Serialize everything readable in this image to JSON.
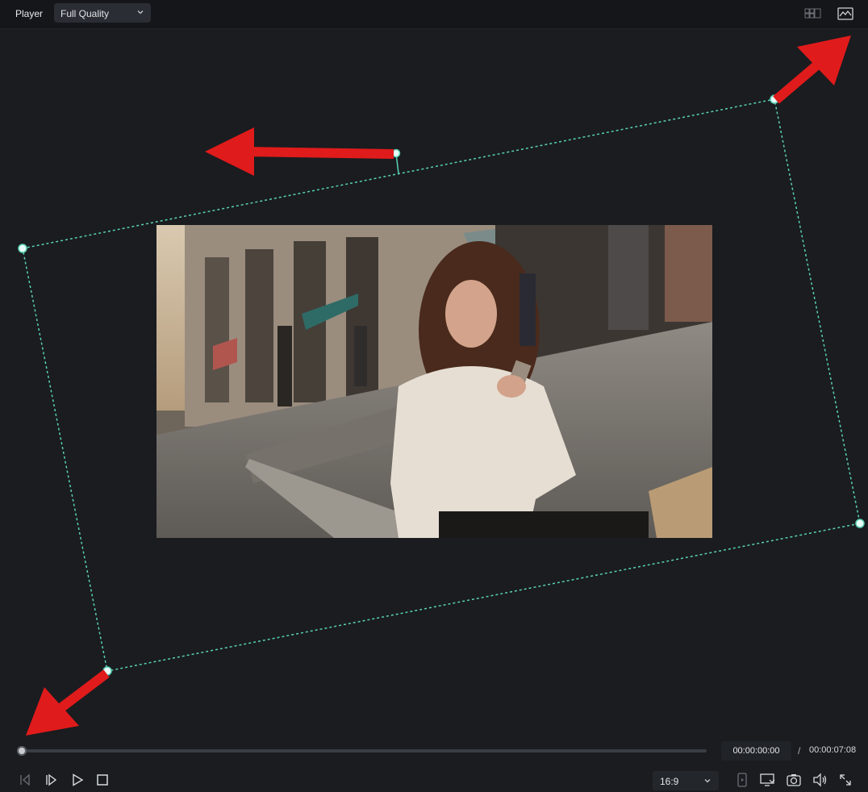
{
  "header": {
    "title": "Player",
    "quality_select": {
      "value": "Full Quality",
      "icon": "chevron-down-icon"
    },
    "right_icons": [
      "grid-view-icon",
      "image-waveform-icon"
    ]
  },
  "preview": {
    "image": "street-photo-woman-with-phone",
    "selection_color": "#5ad1b4",
    "arrow_color": "#e01b1b"
  },
  "timeline": {
    "current_time": "00:00:00:00",
    "separator": "/",
    "total_time": "00:00:07:08",
    "progress": 0
  },
  "controls": {
    "buttons": [
      "previous-frame-icon",
      "next-frame-icon",
      "play-icon",
      "stop-icon"
    ],
    "aspect_ratio": "16:9",
    "right_buttons": [
      "render-preview-icon",
      "display-settings-icon",
      "snapshot-icon",
      "volume-icon",
      "fullscreen-icon"
    ]
  },
  "colors": {
    "background": "#1a1c20",
    "accent": "#5ad1b4",
    "annotation": "#e01b1b"
  }
}
